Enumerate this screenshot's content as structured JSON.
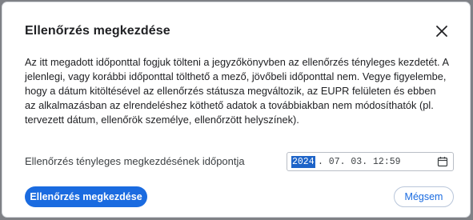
{
  "dialog": {
    "title": "Ellenőrzés megkezdése",
    "close_icon": "close-icon",
    "body_text": "Az itt megadott időponttal fogjuk tölteni a jegyzőkönyvben az ellenőrzés tényleges kezdetét. A jelenlegi, vagy korábbi időponttal tölthető a mező, jövőbeli időponttal nem. Vegye figyelembe, hogy a dátum kitöltésével az ellenőrzés státusza megváltozik, az EUPR felületen és ebben az alkalmazásban az elrendeléshez köthető adatok a továbbiakban nem módosíthatók (pl. tervezett dátum, ellenőrök személye, ellenőrzött helyszínek).",
    "field": {
      "label": "Ellenőrzés tényleges megkezdésének időpontja",
      "year": "2024",
      "rest": ". 07. 03. 12:59",
      "calendar_icon": "calendar-icon"
    },
    "primary_button": "Ellenőrzés megkezdése",
    "secondary_button": "Mégsem"
  },
  "colors": {
    "accent": "#1a6be0",
    "selection": "#1e64c8",
    "overlay": "#7f8186"
  }
}
